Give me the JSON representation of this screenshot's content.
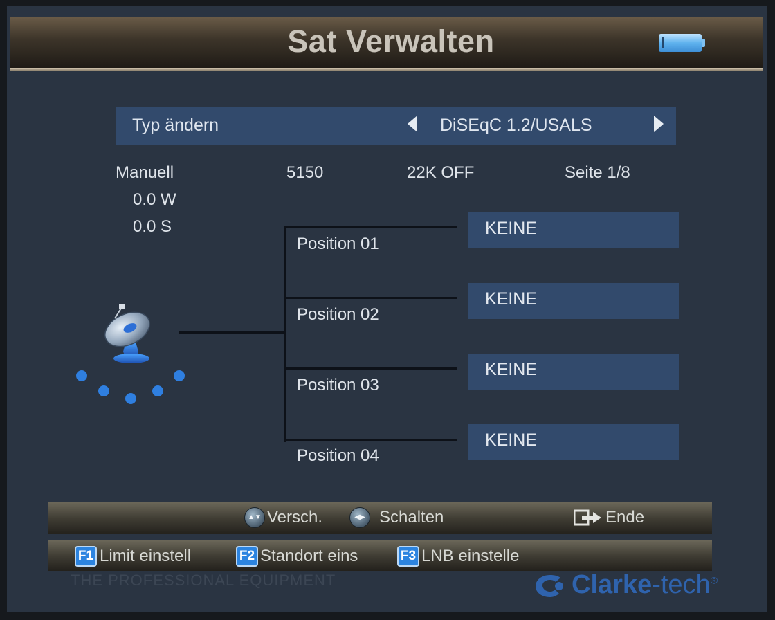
{
  "header": {
    "title": "Sat Verwalten",
    "battery_icon": "battery-icon"
  },
  "type_row": {
    "label": "Typ ändern",
    "value": "DiSEqC 1.2/USALS"
  },
  "info": {
    "mode": "Manuell",
    "frequency": "5150",
    "tone": "22K OFF",
    "page": "Seite 1/8",
    "longitude": "0.0 W",
    "latitude": "0.0 S"
  },
  "positions": [
    {
      "label": "Position 01",
      "satellite": "KEINE"
    },
    {
      "label": "Position 02",
      "satellite": "KEINE"
    },
    {
      "label": "Position 03",
      "satellite": "KEINE"
    },
    {
      "label": "Position 04",
      "satellite": "KEINE"
    }
  ],
  "help_bar": {
    "move_label": "Versch.",
    "switch_label": "Schalten",
    "exit_label": "Ende",
    "up_down_glyph": "▲▼",
    "left_right_glyph": "◀▶"
  },
  "fkeys": [
    {
      "key": "F1",
      "label": "Limit einstell"
    },
    {
      "key": "F2",
      "label": "Standort eins"
    },
    {
      "key": "F3",
      "label": "LNB einstelle"
    }
  ],
  "footer": {
    "watermark": "THE PROFESSIONAL EQUIPMENT",
    "brand_main": "Clarke",
    "brand_suffix": "-tech",
    "brand_reg": "®"
  },
  "colors": {
    "background": "#2a3442",
    "selection": "#324a6c",
    "fkey_blue": "#2c84e0",
    "brand_blue": "#2f63ad"
  }
}
